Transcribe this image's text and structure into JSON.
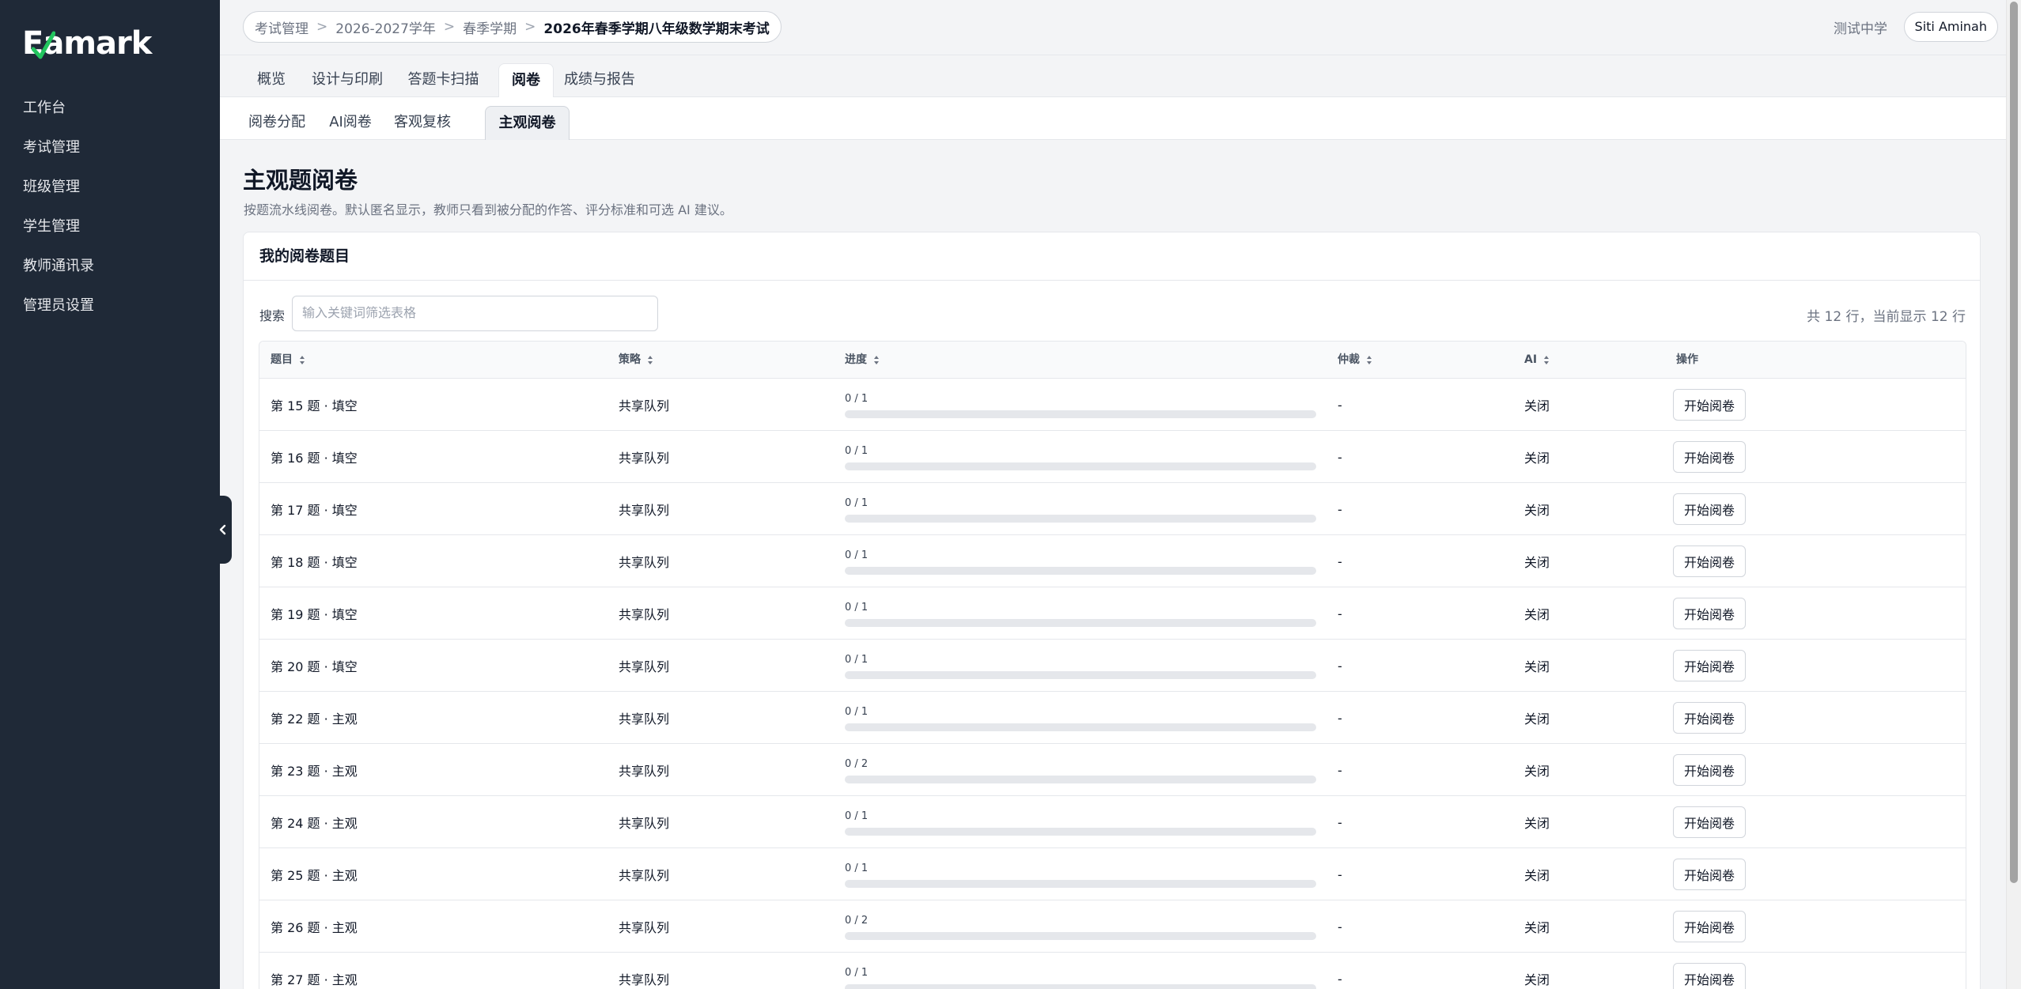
{
  "app": {
    "logo_rest": "amark",
    "logo_e": "E"
  },
  "sidebar": {
    "items": [
      {
        "label": "工作台"
      },
      {
        "label": "考试管理"
      },
      {
        "label": "班级管理"
      },
      {
        "label": "学生管理"
      },
      {
        "label": "教师通讯录"
      },
      {
        "label": "管理员设置"
      }
    ]
  },
  "breadcrumb": {
    "items": [
      "考试管理",
      "2026-2027学年",
      "春季学期"
    ],
    "current": "2026年春季学期八年级数学期末考试",
    "separator": ">"
  },
  "header": {
    "school": "测试中学",
    "user": "Siti Aminah"
  },
  "tabs": [
    "概览",
    "设计与印刷",
    "答题卡扫描",
    "阅卷",
    "成绩与报告"
  ],
  "active_tab": "阅卷",
  "subtabs": [
    "阅卷分配",
    "AI阅卷",
    "客观复核",
    "主观阅卷"
  ],
  "active_subtab": "主观阅卷",
  "page": {
    "title": "主观题阅卷",
    "description": "按题流水线阅卷。默认匿名显示，教师只看到被分配的作答、评分标准和可选 AI 建议。"
  },
  "card": {
    "title": "我的阅卷题目",
    "search_label": "搜索",
    "search_placeholder": "输入关键词筛选表格",
    "search_value": "",
    "row_count": "共 12 行，当前显示 12 行"
  },
  "table": {
    "headers": {
      "question": "题目",
      "strategy": "策略",
      "progress": "进度",
      "arbitration": "仲裁",
      "ai": "AI",
      "action": "操作"
    },
    "rows": [
      {
        "question": "第 15 题 · 填空",
        "strategy": "共享队列",
        "progress_text": "0 / 1",
        "progress": 0,
        "arbitration": "-",
        "ai": "关闭",
        "action": "开始阅卷"
      },
      {
        "question": "第 16 题 · 填空",
        "strategy": "共享队列",
        "progress_text": "0 / 1",
        "progress": 0,
        "arbitration": "-",
        "ai": "关闭",
        "action": "开始阅卷"
      },
      {
        "question": "第 17 题 · 填空",
        "strategy": "共享队列",
        "progress_text": "0 / 1",
        "progress": 0,
        "arbitration": "-",
        "ai": "关闭",
        "action": "开始阅卷"
      },
      {
        "question": "第 18 题 · 填空",
        "strategy": "共享队列",
        "progress_text": "0 / 1",
        "progress": 0,
        "arbitration": "-",
        "ai": "关闭",
        "action": "开始阅卷"
      },
      {
        "question": "第 19 题 · 填空",
        "strategy": "共享队列",
        "progress_text": "0 / 1",
        "progress": 0,
        "arbitration": "-",
        "ai": "关闭",
        "action": "开始阅卷"
      },
      {
        "question": "第 20 题 · 填空",
        "strategy": "共享队列",
        "progress_text": "0 / 1",
        "progress": 0,
        "arbitration": "-",
        "ai": "关闭",
        "action": "开始阅卷"
      },
      {
        "question": "第 22 题 · 主观",
        "strategy": "共享队列",
        "progress_text": "0 / 1",
        "progress": 0,
        "arbitration": "-",
        "ai": "关闭",
        "action": "开始阅卷"
      },
      {
        "question": "第 23 题 · 主观",
        "strategy": "共享队列",
        "progress_text": "0 / 2",
        "progress": 0,
        "arbitration": "-",
        "ai": "关闭",
        "action": "开始阅卷"
      },
      {
        "question": "第 24 题 · 主观",
        "strategy": "共享队列",
        "progress_text": "0 / 1",
        "progress": 0,
        "arbitration": "-",
        "ai": "关闭",
        "action": "开始阅卷"
      },
      {
        "question": "第 25 题 · 主观",
        "strategy": "共享队列",
        "progress_text": "0 / 1",
        "progress": 0,
        "arbitration": "-",
        "ai": "关闭",
        "action": "开始阅卷"
      },
      {
        "question": "第 26 题 · 主观",
        "strategy": "共享队列",
        "progress_text": "0 / 2",
        "progress": 0,
        "arbitration": "-",
        "ai": "关闭",
        "action": "开始阅卷"
      },
      {
        "question": "第 27 题 · 主观",
        "strategy": "共享队列",
        "progress_text": "0 / 1",
        "progress": 0,
        "arbitration": "-",
        "ai": "关闭",
        "action": "开始阅卷"
      }
    ]
  },
  "colors": {
    "sidebar_bg": "#1f2937",
    "accent": "#2563eb",
    "border": "#e5e7eb"
  },
  "icons": {
    "sort": "sort-icon",
    "collapse": "chevron-left-icon",
    "logo_check": "check-icon"
  }
}
